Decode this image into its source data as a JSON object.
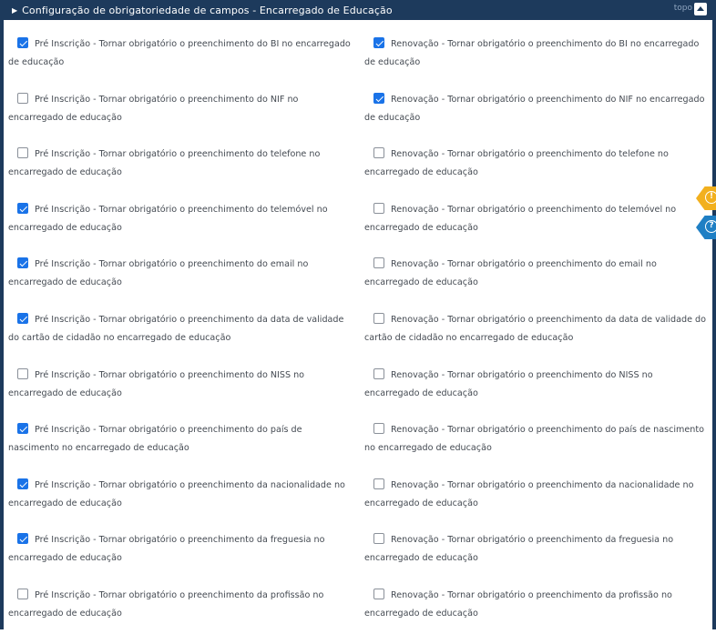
{
  "header": {
    "title": "Configuração de obrigatoriedade de campos - Encarregado de Educação",
    "topo_label": "topo"
  },
  "colors": {
    "header_bg": "#1d3a5c",
    "checkbox_on": "#1a73e8",
    "warning_badge": "#f2b01e",
    "help_badge": "#1f7fc4"
  },
  "rows": [
    {
      "left": {
        "checked": true,
        "text": "Pré Inscrição - Tornar obrigatório o preenchimento do BI no encarregado de educação"
      },
      "right": {
        "checked": true,
        "text": "Renovação - Tornar obrigatório o preenchimento do BI no encarregado de educação"
      }
    },
    {
      "left": {
        "checked": false,
        "text": "Pré Inscrição - Tornar obrigatório o preenchimento do NIF no encarregado de educação"
      },
      "right": {
        "checked": true,
        "text": "Renovação - Tornar obrigatório o preenchimento do NIF no encarregado de educação"
      }
    },
    {
      "left": {
        "checked": false,
        "text": "Pré Inscrição - Tornar obrigatório o preenchimento do telefone no encarregado de educação"
      },
      "right": {
        "checked": false,
        "text": "Renovação - Tornar obrigatório o preenchimento do telefone no encarregado de educação"
      }
    },
    {
      "left": {
        "checked": true,
        "text": "Pré Inscrição - Tornar obrigatório o preenchimento do telemóvel no encarregado de educação"
      },
      "right": {
        "checked": false,
        "text": "Renovação - Tornar obrigatório o preenchimento do telemóvel no encarregado de educação"
      }
    },
    {
      "left": {
        "checked": true,
        "text": "Pré Inscrição - Tornar obrigatório o preenchimento do email no encarregado de educação"
      },
      "right": {
        "checked": false,
        "text": "Renovação - Tornar obrigatório o preenchimento do email no encarregado de educação"
      }
    },
    {
      "left": {
        "checked": true,
        "text": "Pré Inscrição - Tornar obrigatório o preenchimento da data de validade do cartão de cidadão no encarregado de educação"
      },
      "right": {
        "checked": false,
        "text": "Renovação - Tornar obrigatório o preenchimento da data de validade do cartão de cidadão no encarregado de educação"
      }
    },
    {
      "left": {
        "checked": false,
        "text": "Pré Inscrição - Tornar obrigatório o preenchimento do NISS no encarregado de educação"
      },
      "right": {
        "checked": false,
        "text": "Renovação - Tornar obrigatório o preenchimento do NISS no encarregado de educação"
      }
    },
    {
      "left": {
        "checked": true,
        "text": "Pré Inscrição - Tornar obrigatório o preenchimento do país de nascimento no encarregado de educação"
      },
      "right": {
        "checked": false,
        "text": "Renovação - Tornar obrigatório o preenchimento do país de nascimento no encarregado de educação"
      }
    },
    {
      "left": {
        "checked": true,
        "text": "Pré Inscrição - Tornar obrigatório o preenchimento da nacionalidade no encarregado de educação"
      },
      "right": {
        "checked": false,
        "text": "Renovação - Tornar obrigatório o preenchimento da nacionalidade no encarregado de educação"
      }
    },
    {
      "left": {
        "checked": true,
        "text": "Pré Inscrição - Tornar obrigatório o preenchimento da freguesia no encarregado de educação"
      },
      "right": {
        "checked": false,
        "text": "Renovação - Tornar obrigatório o preenchimento da freguesia no encarregado de educação"
      }
    },
    {
      "left": {
        "checked": false,
        "text": "Pré Inscrição - Tornar obrigatório o preenchimento da profissão no encarregado de educação"
      },
      "right": {
        "checked": false,
        "text": "Renovação - Tornar obrigatório o preenchimento da profissão no encarregado de educação"
      }
    }
  ],
  "side_badges": [
    {
      "icon": "warning-icon",
      "glyph": "!"
    },
    {
      "icon": "help-icon",
      "glyph": "?"
    }
  ]
}
